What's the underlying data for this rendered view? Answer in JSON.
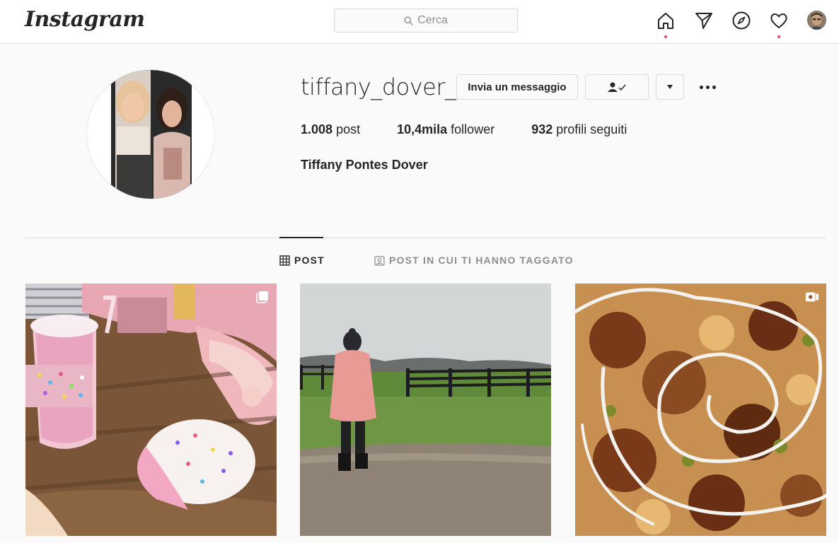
{
  "header": {
    "logo": "Instagram",
    "search_placeholder": "Cerca",
    "nav": [
      "home-icon",
      "direct-icon",
      "explore-icon",
      "activity-icon",
      "avatar"
    ]
  },
  "profile": {
    "username": "tiffany_dover_",
    "message_button": "Invia un messaggio",
    "stats": {
      "posts_count": "1.008",
      "posts_label": "post",
      "followers_count": "10,4mila",
      "followers_label": "follower",
      "following_count": "932",
      "following_label": "profili seguiti"
    },
    "full_name": "Tiffany Pontes Dover"
  },
  "tabs": [
    {
      "label": "POST",
      "active": true,
      "icon": "grid-icon"
    },
    {
      "label": "POST IN CUI TI HANNO TAGGATO",
      "active": false,
      "icon": "tagged-icon"
    }
  ],
  "posts": [
    {
      "subject": "milkshake",
      "badge": "carousel-icon"
    },
    {
      "subject": "field-walk",
      "badge": ""
    },
    {
      "subject": "pizza",
      "badge": "video-icon"
    }
  ],
  "colors": {
    "notification_dot": "#ed4956",
    "border": "#dbdbdb",
    "background": "#fafafa"
  }
}
